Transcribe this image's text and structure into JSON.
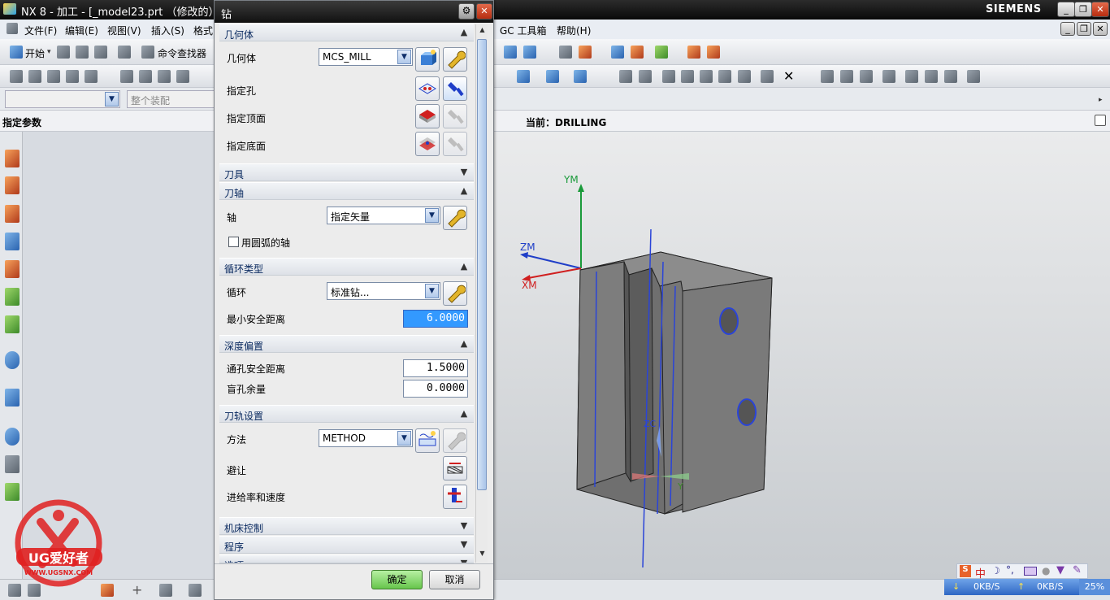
{
  "app": {
    "title": "NX 8 - 加工 - [_model23.prt （修改的）]",
    "brand": "SIEMENS",
    "window_buttons": [
      "_",
      "❐",
      "✕"
    ]
  },
  "menubar": {
    "left_items": [
      "文件(F)",
      "编辑(E)",
      "视图(V)",
      "插入(S)",
      "格式"
    ],
    "right_items": [
      "GC 工具箱",
      "帮助(H)"
    ]
  },
  "toolbar": {
    "start_label": "开始",
    "command_finder": "命令查找器",
    "filter_placeholder": "",
    "assembly_scope": "整个装配"
  },
  "param_header": {
    "left": "指定参数",
    "current": "当前：DRILLING"
  },
  "dialog": {
    "title": "钻",
    "sections": {
      "geometry": "几何体",
      "tool": "刀具",
      "tool_axis": "刀轴",
      "cycle_type": "循环类型",
      "depth_offset": "深度偏置",
      "path_settings": "刀轨设置",
      "machine_control": "机床控制",
      "program": "程序",
      "options": "选项"
    },
    "geometry": {
      "label": "几何体",
      "value": "MCS_MILL",
      "specify_hole": "指定孔",
      "specify_top": "指定顶面",
      "specify_bottom": "指定底面"
    },
    "axis": {
      "label": "轴",
      "value": "指定矢量",
      "arc_axis_label": "用圆弧的轴"
    },
    "cycle": {
      "label": "循环",
      "value": "标准钻...",
      "min_clearance_label": "最小安全距离",
      "min_clearance_value": "6.0000"
    },
    "depth": {
      "through_label": "通孔安全距离",
      "through_value": "1.5000",
      "blind_label": "盲孔余量",
      "blind_value": "0.0000"
    },
    "path": {
      "method_label": "方法",
      "method_value": "METHOD",
      "avoid_label": "避让",
      "feeds_label": "进给率和速度"
    },
    "ok": "确定",
    "cancel": "取消"
  },
  "viewport": {
    "axis_labels": {
      "ym": "YM",
      "zm": "ZM",
      "xm": "XM",
      "zc": "ZC",
      "yc": "Y"
    }
  },
  "status": {
    "download": "0KB/S",
    "upload": "0KB/S",
    "percent": "25%"
  },
  "watermark": {
    "text": "UG爱好者",
    "url": "WWW.UGSNX.COM"
  },
  "colors": {
    "dialog_header_text": "#0a2a60",
    "ok_button": "#67c54c",
    "selected_field": "#3399ff",
    "ym_axis": "#1a9a3a",
    "zm_axis": "#1f3ec8",
    "xm_axis": "#d02020",
    "part_face": "#7a7a7a"
  }
}
